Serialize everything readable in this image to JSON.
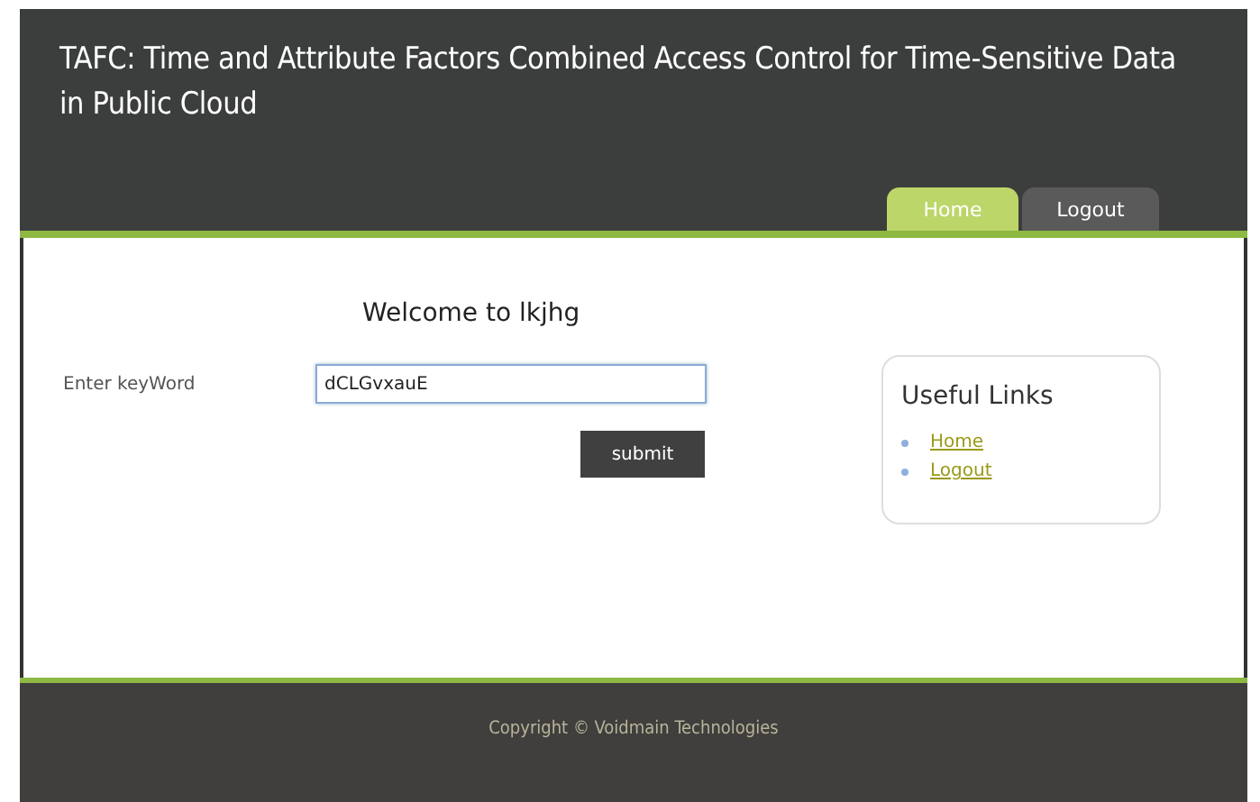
{
  "header": {
    "title": "TAFC: Time and Attribute Factors Combined Access Control for Time-Sensitive Data in Public Cloud"
  },
  "tabs": [
    {
      "label": "Home",
      "selected": true
    },
    {
      "label": "Logout",
      "selected": false
    }
  ],
  "welcome": "Welcome to lkjhg",
  "form": {
    "label": "Enter keyWord",
    "value": "dCLGvxauE",
    "button": "submit"
  },
  "useful_links": {
    "title": "Useful Links",
    "items": [
      "Home",
      "Logout"
    ]
  },
  "footer": {
    "text": "Copyright © Voidmain Technologies"
  }
}
